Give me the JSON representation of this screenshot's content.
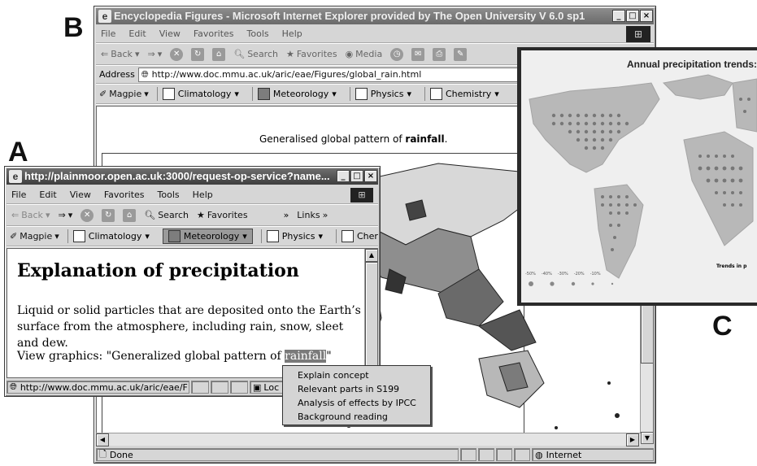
{
  "labels": {
    "a": "A",
    "b": "B",
    "c": "C"
  },
  "window_b": {
    "title": "Encyclopedia Figures - Microsoft Internet Explorer provided by The Open University V 6.0 sp1",
    "menu": [
      "File",
      "Edit",
      "View",
      "Favorites",
      "Tools",
      "Help"
    ],
    "toolbar": {
      "back": "Back",
      "search": "Search",
      "favorites": "Favorites",
      "media": "Media"
    },
    "address_label": "Address",
    "address": "http://www.doc.mmu.ac.uk/aric/eae/Figures/global_rain.html",
    "links": [
      "Magpie",
      "Climatology",
      "Meteorology",
      "Physics",
      "Chemistry"
    ],
    "caption_prefix": "Generalised global pattern of",
    "caption_bold": "rainfall",
    "caption_suffix": ".",
    "status": "Done",
    "zone": "Internet"
  },
  "window_a": {
    "title": "http://plainmoor.open.ac.uk:3000/request-op-service?name...",
    "menu": [
      "File",
      "Edit",
      "View",
      "Favorites",
      "Tools",
      "Help"
    ],
    "toolbar": {
      "back": "Back",
      "search": "Search",
      "favorites": "Favorites",
      "links": "Links"
    },
    "links": [
      "Magpie",
      "Climatology",
      "Meteorology",
      "Physics",
      "Cher"
    ],
    "heading": "Explanation of precipitation",
    "body": "Liquid or solid particles that are deposited onto the Earth’s surface from the atmosphere, including rain, snow, sleet and dew.",
    "view_prefix": "View graphics: \"Generalized global pattern of",
    "view_highlight": "rainfall",
    "view_suffix": "\"",
    "status": "http://www.doc.mmu.ac.uk/aric/eae/F",
    "status_local": "Loc"
  },
  "context_menu": [
    "Explain concept",
    "Relevant parts in S199",
    "Analysis of effects by IPCC",
    "Background reading"
  ],
  "panel_c": {
    "title": "Annual precipitation trends:",
    "legend_title": "Trends in p",
    "legend_values": [
      "-50%",
      "-40%",
      "-30%",
      "-20%",
      "-10%"
    ]
  }
}
